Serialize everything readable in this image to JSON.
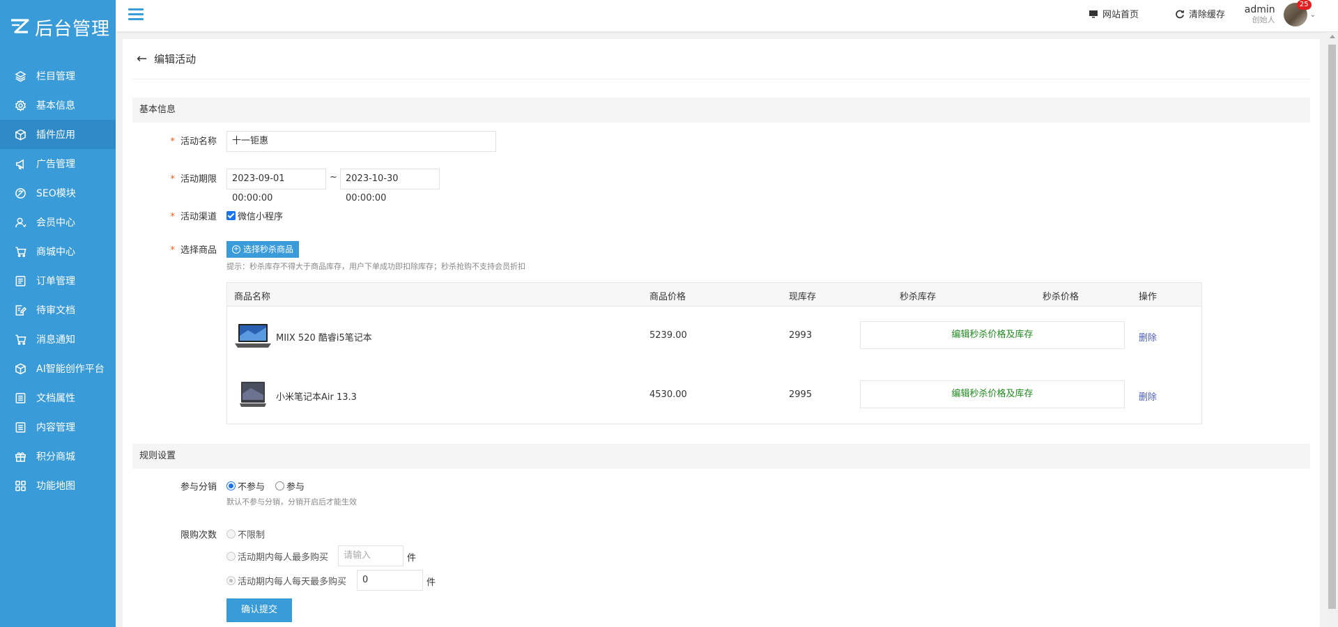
{
  "app": {
    "logo_text": "后台管理"
  },
  "colors": {
    "sidebar": "#3a9bd9",
    "accent": "#3a9bd9",
    "required": "#f05a1a",
    "edit_text": "#1f8a1f",
    "delete_link": "#4f5fc8",
    "badge": "#e02020"
  },
  "sidebar": {
    "items": [
      {
        "label": "栏目管理",
        "icon": "layers-icon",
        "active": false
      },
      {
        "label": "基本信息",
        "icon": "gear-icon",
        "active": false
      },
      {
        "label": "插件应用",
        "icon": "cube-icon",
        "active": true
      },
      {
        "label": "广告管理",
        "icon": "megaphone-icon",
        "active": false
      },
      {
        "label": "SEO模块",
        "icon": "seo-icon",
        "active": false
      },
      {
        "label": "会员中心",
        "icon": "user-icon",
        "active": false
      },
      {
        "label": "商城中心",
        "icon": "cart-icon",
        "active": false
      },
      {
        "label": "订单管理",
        "icon": "list-icon",
        "active": false
      },
      {
        "label": "待审文档",
        "icon": "edit-doc-icon",
        "active": false
      },
      {
        "label": "消息通知",
        "icon": "cart-icon",
        "active": false
      },
      {
        "label": "AI智能创作平台",
        "icon": "cube-icon",
        "active": false
      },
      {
        "label": "文档属性",
        "icon": "doc-icon",
        "active": false
      },
      {
        "label": "内容管理",
        "icon": "doc-icon",
        "active": false
      },
      {
        "label": "积分商城",
        "icon": "gift-icon",
        "active": false
      },
      {
        "label": "功能地图",
        "icon": "grid-icon",
        "active": false
      }
    ]
  },
  "topbar": {
    "home_link": "网站首页",
    "clear_cache": "清除缓存",
    "user_name": "admin",
    "user_role": "创始人",
    "badge_count": "25"
  },
  "page": {
    "title": "编辑活动",
    "section_basic": "基本信息",
    "section_rules": "规则设置",
    "submit_label": "确认提交"
  },
  "form": {
    "name_label": "活动名称",
    "name_value": "十一钜惠",
    "period_label": "活动期限",
    "start_value": "2023-09-01 00:00:00",
    "period_sep": "~",
    "end_value": "2023-10-30 00:00:00",
    "channel_label": "活动渠道",
    "channel_option": "微信小程序",
    "channel_checked": true,
    "goods_label": "选择商品",
    "goods_button": "选择秒杀商品",
    "goods_hint": "提示：秒杀库存不得大于商品库存，用户下单成功即扣除库存；秒杀抢购不支持会员折扣",
    "distribution_label": "参与分销",
    "distribution_options": [
      "不参与",
      "参与"
    ],
    "distribution_selected": "不参与",
    "distribution_hint": "默认不参与分销，分销开启后才能生效",
    "limit_label": "限购次数",
    "limit_unlimited": "不限制",
    "limit_per_person": "活动期内每人最多购买",
    "limit_per_person_placeholder": "请输入",
    "limit_per_day": "活动期内每人每天最多购买",
    "limit_per_day_value": "0",
    "unit": "件"
  },
  "goods_table": {
    "headers": [
      "商品名称",
      "商品价格",
      "现库存",
      "秒杀库存",
      "秒杀价格",
      "操作"
    ],
    "rows": [
      {
        "name": "MIIX 520 酷睿i5笔记本",
        "price": "5239.00",
        "stock": "2993",
        "edit": "编辑秒杀价格及库存",
        "action": "删除",
        "image": "laptop-image"
      },
      {
        "name": "小米笔记本Air 13.3",
        "price": "4530.00",
        "stock": "2995",
        "edit": "编辑秒杀价格及库存",
        "action": "删除",
        "image": "laptop-image"
      }
    ]
  }
}
